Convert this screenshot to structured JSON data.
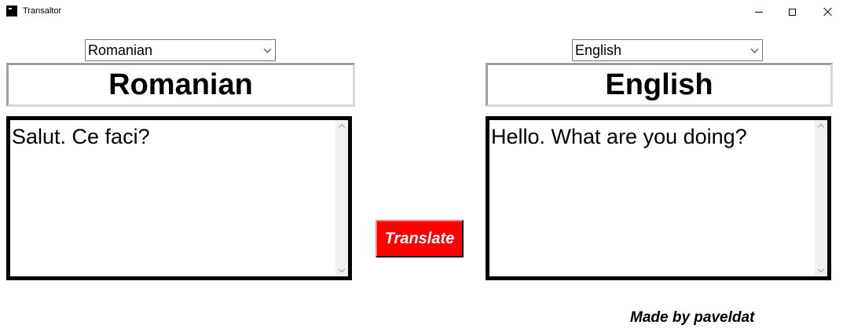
{
  "window": {
    "title": "Transaltor",
    "icon": "app-icon"
  },
  "controls": {
    "minimize_icon": "minimize-icon",
    "maximize_icon": "maximize-icon",
    "close_icon": "close-icon"
  },
  "source": {
    "select_value": "Romanian",
    "heading": "Romanian",
    "text": "Salut. Ce faci?"
  },
  "target": {
    "select_value": "English",
    "heading": "English",
    "text": "Hello. What are you doing?"
  },
  "translate_button": {
    "label": "Translate",
    "color": "#ff0000"
  },
  "footer": {
    "credit": "Made by paveldat"
  }
}
